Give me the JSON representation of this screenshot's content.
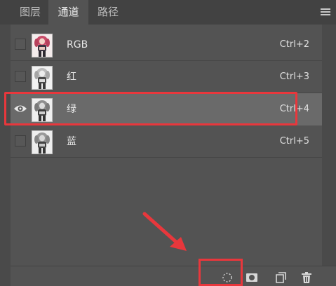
{
  "tabs": [
    {
      "label": "图层",
      "active": false
    },
    {
      "label": "通道",
      "active": true
    },
    {
      "label": "路径",
      "active": false
    }
  ],
  "panel_menu_icon": "hamburger-menu-icon",
  "channels": [
    {
      "name": "RGB",
      "shortcut": "Ctrl+2",
      "visible": false,
      "selected": false,
      "thumb": "color"
    },
    {
      "name": "红",
      "shortcut": "Ctrl+3",
      "visible": false,
      "selected": false,
      "thumb": "gray"
    },
    {
      "name": "绿",
      "shortcut": "Ctrl+4",
      "visible": true,
      "selected": true,
      "thumb": "gray"
    },
    {
      "name": "蓝",
      "shortcut": "Ctrl+5",
      "visible": false,
      "selected": false,
      "thumb": "gray"
    }
  ],
  "footer_icons": [
    "load-channel-as-selection-icon",
    "save-selection-as-channel-icon",
    "new-channel-icon",
    "delete-channel-icon"
  ],
  "colors": {
    "highlight": "#e8373c",
    "panel": "#535353",
    "selected_row": "#6a6a6a"
  }
}
